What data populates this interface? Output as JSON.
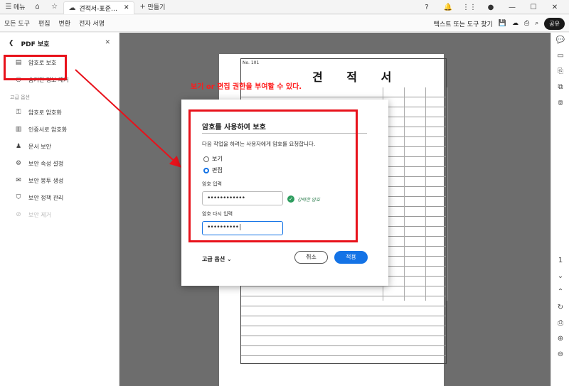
{
  "titlebar": {
    "menu_label": "메뉴",
    "doc_tab": "견적서-표준양식...",
    "new_tab": "만들기"
  },
  "menubar": {
    "items": [
      "모든 도구",
      "편집",
      "변환",
      "전자 서명"
    ],
    "search_placeholder": "텍스트 또는 도구 찾기",
    "share": "공유"
  },
  "leftpanel": {
    "title": "PDF 보호",
    "item_password": "암호로 보호",
    "item_hidden": "숨겨진 정보 제거",
    "section_more": "고급 옵션",
    "item_redact": "암호로 암호화",
    "item_cert": "인증서로 암호화",
    "item_doc": "문서 보안",
    "item_props": "보안 속성 설정",
    "item_policy_create": "보안 봉투 생성",
    "item_policy_manage": "보안 정책 관리",
    "item_remove": "보안 제거"
  },
  "document": {
    "no": "No.  101",
    "title": "견 적 서"
  },
  "annotation": "보기 or 편집 권한을 부여할 수 있다.",
  "modal": {
    "title": "암호를 사용하여 보호",
    "description": "다음 작업을 하려는 사용자에게 암호를 요청합니다.",
    "option_view": "보기",
    "option_edit": "편집",
    "password_label": "암호 입력",
    "password_value": "••••••••••••",
    "strength": "강력한 암호",
    "confirm_label": "암호 다시 입력",
    "confirm_value": "••••••••••|",
    "advanced": "고급 옵션",
    "cancel": "취소",
    "apply": "적용"
  },
  "colors": {
    "accent": "#1473e6",
    "highlight": "#e8121b"
  }
}
